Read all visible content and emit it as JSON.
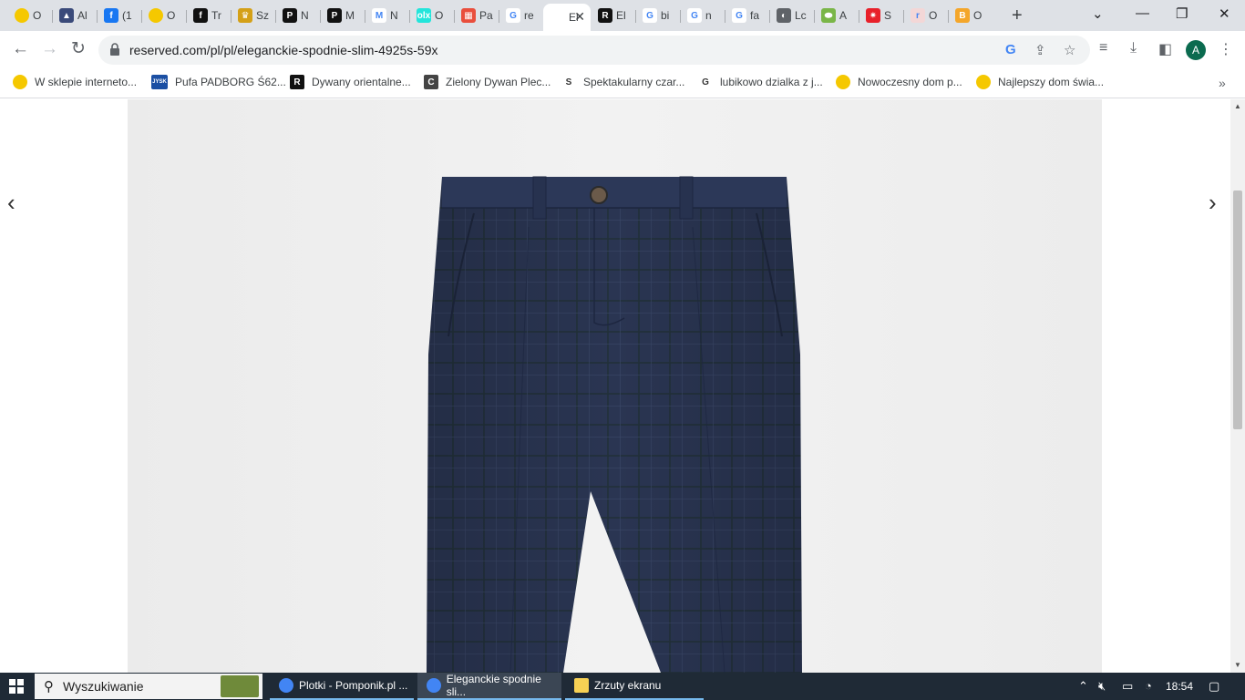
{
  "browser": {
    "tabs": [
      {
        "title": "O",
        "color": "#f5c800",
        "glyph": ""
      },
      {
        "title": "Al",
        "color": "#3a4a7a",
        "glyph": "▲"
      },
      {
        "title": "(1",
        "color": "#1877f2",
        "glyph": "f"
      },
      {
        "title": "O",
        "color": "#f5c800",
        "glyph": ""
      },
      {
        "title": "Tr",
        "color": "#111111",
        "glyph": "f"
      },
      {
        "title": "Sz",
        "color": "#d4a017",
        "glyph": "♛"
      },
      {
        "title": "N",
        "color": "#111111",
        "glyph": "P"
      },
      {
        "title": "M",
        "color": "#111111",
        "glyph": "P"
      },
      {
        "title": "N",
        "color": "#ffffff",
        "glyph": "M"
      },
      {
        "title": "O",
        "color": "#23e5db",
        "glyph": "olx"
      },
      {
        "title": "Pa",
        "color": "#e94e3c",
        "glyph": "▦"
      },
      {
        "title": "re",
        "color": "#ffffff",
        "glyph": "G"
      },
      {
        "title": "El",
        "color": "#ffffff",
        "glyph": "",
        "active": true
      },
      {
        "title": "El",
        "color": "#111111",
        "glyph": "R"
      },
      {
        "title": "bi",
        "color": "#ffffff",
        "glyph": "G"
      },
      {
        "title": "n",
        "color": "#ffffff",
        "glyph": "G"
      },
      {
        "title": "fa",
        "color": "#ffffff",
        "glyph": "G"
      },
      {
        "title": "Lc",
        "color": "#5f6368",
        "glyph": "◐"
      },
      {
        "title": "A",
        "color": "#7ab648",
        "glyph": "⬬"
      },
      {
        "title": "S",
        "color": "#e8202a",
        "glyph": "✷"
      },
      {
        "title": "O",
        "color": "#f3d7d7",
        "glyph": "r"
      },
      {
        "title": "O",
        "color": "#f4a62a",
        "glyph": "B"
      }
    ],
    "new_tab_label": "+",
    "url": "reserved.com/pl/pl/eleganckie-spodnie-slim-4925s-59x",
    "profile_initial": "A",
    "bookmarks": [
      {
        "label": "W sklepie interneto...",
        "color": "#f5c800",
        "glyph": ""
      },
      {
        "label": "Pufa PADBORG Ś62...",
        "color": "#1b4fa3",
        "glyph": "JYSK"
      },
      {
        "label": "Dywany orientalne...",
        "color": "#111111",
        "glyph": "R"
      },
      {
        "label": "Zielony Dywan Plec...",
        "color": "#444444",
        "glyph": "C"
      },
      {
        "label": "Spektakularny czar...",
        "color": "#ffffff",
        "glyph": "S"
      },
      {
        "label": "lubikowo dzialka z j...",
        "color": "#ffffff",
        "glyph": "G"
      },
      {
        "label": "Nowoczesny dom p...",
        "color": "#f5c800",
        "glyph": ""
      },
      {
        "label": "Najlepszy dom świa...",
        "color": "#f5c800",
        "glyph": ""
      }
    ]
  },
  "taskbar": {
    "search_placeholder": "Wyszukiwanie",
    "apps": [
      {
        "label": "Plotki - Pomponik.pl ...",
        "active": false
      },
      {
        "label": "Eleganckie spodnie sli...",
        "active": true
      },
      {
        "label": "Zrzuty ekranu",
        "active": false
      }
    ],
    "time": "18:54"
  }
}
